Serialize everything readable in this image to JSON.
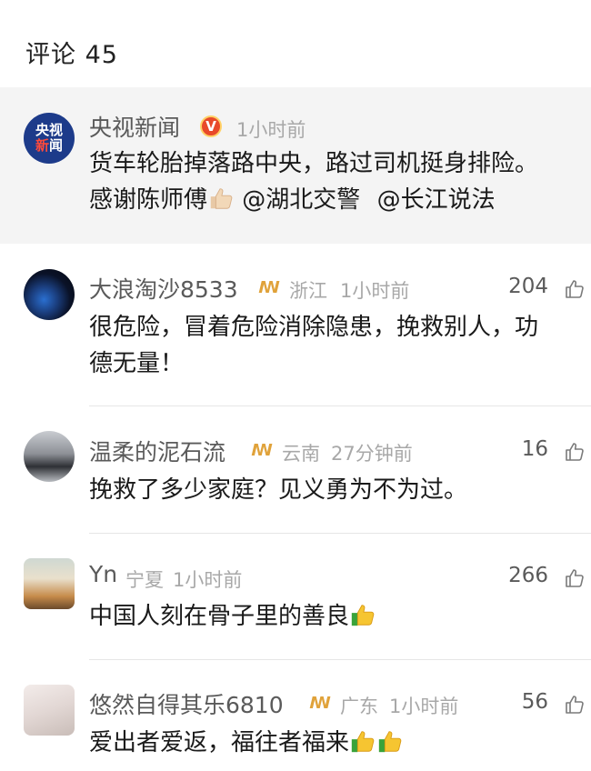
{
  "header": {
    "title": "评论 45"
  },
  "pinned": {
    "avatar_line1": "央视",
    "avatar_line2a": "新",
    "avatar_line2b": "闻",
    "name": "央视新闻",
    "verified_badge": "V",
    "time": "1小时前",
    "line1": "货车轮胎掉落路中央，路过司机挺身排险。",
    "line2_text": "感谢陈师傅",
    "line2_emoji": "thumbs-up-emoji",
    "mention1": "@湖北交警",
    "mention2": "@长江说法"
  },
  "comments": [
    {
      "name": "大浪淘沙8533",
      "location": "浙江",
      "time": "1小时前",
      "likes": "204",
      "line1": "很危险，冒着危险消除隐患，挽救别人，功",
      "line2": "德无量！"
    },
    {
      "name": "温柔的泥石流",
      "location": "云南",
      "time": "27分钟前",
      "likes": "16",
      "line1": "挽救了多少家庭？见义勇为不为过。"
    },
    {
      "name": "Yn",
      "location": "宁夏",
      "time": "1小时前",
      "likes": "266",
      "line1": "中国人刻在骨子里的善良",
      "emoji_count": 1
    },
    {
      "name": "悠然自得其乐6810",
      "location": "广东",
      "time": "1小时前",
      "likes": "56",
      "line1": "爱出者爱返，福往者福来",
      "emoji_count": 2
    }
  ],
  "colors": {
    "pinned_bg": "#f4f4f4",
    "name": "#5a5a5a",
    "meta": "#a8a8a8",
    "vip_badge": "#e0a23a",
    "verified_badge": "#e8492a"
  },
  "icons": {
    "like": "thumbs-up-outline-icon",
    "vip": "vip-badge-icon"
  }
}
